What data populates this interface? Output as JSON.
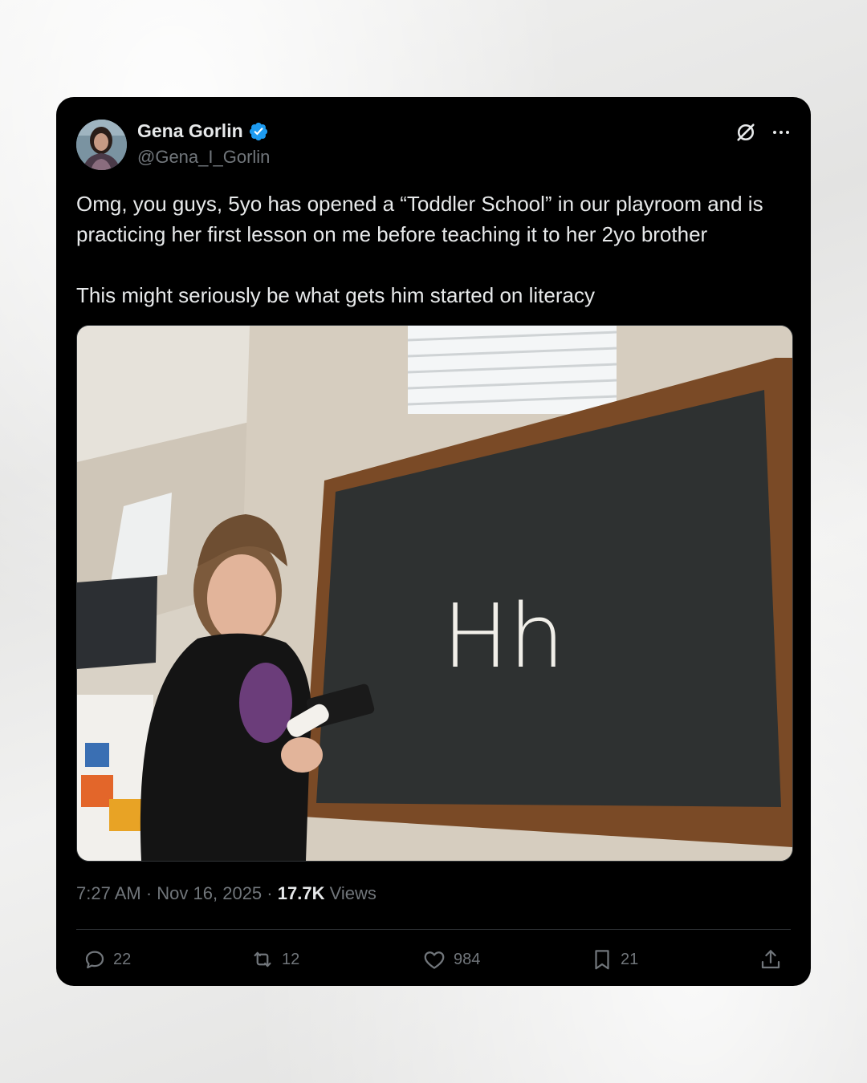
{
  "post": {
    "author": {
      "display_name": "Gena Gorlin",
      "handle": "@Gena_I_Gorlin",
      "verified": true,
      "badge_color": "#1d9bf0"
    },
    "text": [
      "Omg, you guys, 5yo has opened a “Toddler School” in our playroom and is practicing her first lesson on me before teaching it to her 2yo brother",
      "This might seriously be what gets him started on literacy"
    ],
    "media": {
      "chalkboard_text": "Hh"
    },
    "time": "7:27 AM",
    "date": "Nov 16, 2025",
    "separator": "·",
    "views_count": "17.7K",
    "views_label": "Views"
  },
  "actions": {
    "replies": "22",
    "reposts": "12",
    "likes": "984",
    "bookmarks": "21"
  },
  "icons": [
    "grok-icon",
    "more-icon",
    "reply-icon",
    "repost-icon",
    "like-icon",
    "bookmark-icon",
    "share-icon",
    "verified-badge-icon"
  ],
  "colors": {
    "card_background": "#000000",
    "text_primary": "#e7e9ea",
    "text_secondary": "#71767b",
    "divider": "#2f3336",
    "page_background": "#ececeb"
  }
}
